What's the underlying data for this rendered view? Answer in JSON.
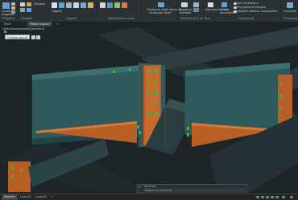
{
  "ribbon": {
    "items": [
      {
        "label": "Cambia",
        "sub": "progetto"
      },
      {
        "label": "Progetto",
        "sub": ""
      },
      {
        "label": "Disegno",
        "sub": ""
      },
      {
        "label": "Oggetti",
        "sub": ""
      },
      {
        "label": "Trasforma degli elementi",
        "sub": "strutturali finali"
      },
      {
        "label": "Aggiorna",
        "sub": "modello"
      },
      {
        "label": "Documentazione",
        "sub": ""
      },
      {
        "label": "Crea",
        "sub": "documento"
      },
      {
        "label": "Info di disegno",
        "sub": ""
      },
      {
        "label": "Proprietà di disegno",
        "sub": ""
      },
      {
        "label": "Modelli didattici componenti",
        "sub": ""
      },
      {
        "label": "Controllo",
        "sub": ""
      }
    ],
    "groups": [
      "Progetto",
      "Disegno",
      "Oggetti",
      "Modellazione reale",
      "Documenti & verifica",
      "Documenti",
      "Strumenti"
    ]
  },
  "tabs": {
    "items": [
      "Start",
      "Pilastri-Legno",
      "Modello"
    ],
    "active": 1
  },
  "viewport": {
    "label": "[Vista personalizzata][Realistico]",
    "dropdown_value": "Cambio giunti"
  },
  "command": {
    "history": "Comando:",
    "placeholder": "Digitare un comando"
  },
  "status": {
    "tabs": [
      "Modello",
      "Layout1",
      "Layout2"
    ],
    "active": 0
  },
  "colors": {
    "accent_orange": "#c66b2b",
    "bolt_green": "#3fb34f",
    "steel_cyan": "#2e5f62",
    "background": "#1c2326"
  }
}
